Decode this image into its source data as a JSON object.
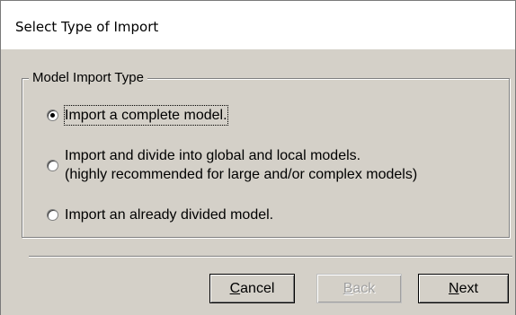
{
  "window": {
    "title": "Select Type of Import"
  },
  "group": {
    "label": "Model Import Type",
    "options": [
      {
        "line1": "Import a complete model.",
        "checked": true
      },
      {
        "line1": "Import and divide into global and local models.",
        "line2": "(highly recommended for large and/or complex models)",
        "checked": false
      },
      {
        "line1": "Import an already divided model.",
        "checked": false
      }
    ]
  },
  "buttons": {
    "cancel": {
      "accel": "C",
      "rest": "ancel"
    },
    "back": {
      "accel": "B",
      "rest": "ack",
      "disabled": true
    },
    "next": {
      "accel": "N",
      "rest": "ext"
    }
  }
}
